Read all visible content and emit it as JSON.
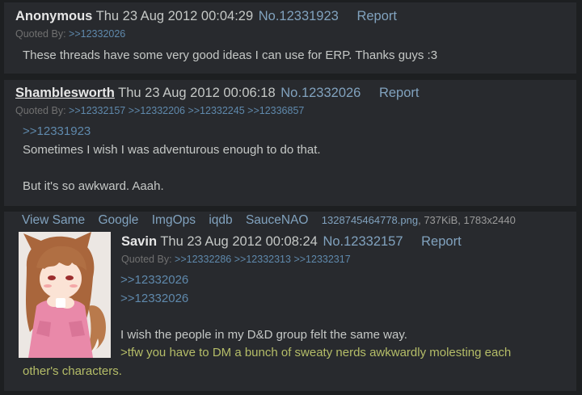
{
  "posts": [
    {
      "name": "Anonymous",
      "date": "Thu 23 Aug 2012 00:04:29",
      "number": "No.12331923",
      "report": "Report",
      "quoted_by_label": "Quoted By:",
      "quoted_by": [
        ">>12332026"
      ],
      "lines": [
        "These threads have some very good ideas I can use for ERP. Thanks guys :3"
      ]
    },
    {
      "name": "Shamblesworth",
      "date": "Thu 23 Aug 2012 00:06:18",
      "number": "No.12332026",
      "report": "Report",
      "quoted_by_label": "Quoted By:",
      "quoted_by": [
        ">>12332157",
        ">>12332206",
        ">>12332245",
        ">>12336857"
      ],
      "quote": ">>12331923",
      "lines": [
        "Sometimes I wish I was adventurous enough to do that.",
        "But it's so awkward. Aaah."
      ]
    },
    {
      "file_links": [
        "View Same",
        "Google",
        "ImgOps",
        "iqdb",
        "SauceNAO"
      ],
      "file_name": "1328745464778.png",
      "file_info": ", 737KiB, 1783x2440",
      "image_alt": "anime wolf girl thumbnail",
      "name": "Savin",
      "date": "Thu 23 Aug 2012 00:08:24",
      "number": "No.12332157",
      "report": "Report",
      "quoted_by_label": "Quoted By:",
      "quoted_by": [
        ">>12332286",
        ">>12332313",
        ">>12332317"
      ],
      "quotes": [
        ">>12332026",
        ">>12332026"
      ],
      "lines": [
        "I wish the people in my D&D group felt the same way."
      ],
      "greentext_1": ">tfw you have to DM a bunch of sweaty nerds awkwardly molesting each",
      "greentext_2": "other's characters."
    }
  ],
  "colors": {
    "background": "#1d1f21",
    "post_bg": "#282a2e",
    "link": "#81a2be",
    "greentext": "#b5bd68"
  }
}
